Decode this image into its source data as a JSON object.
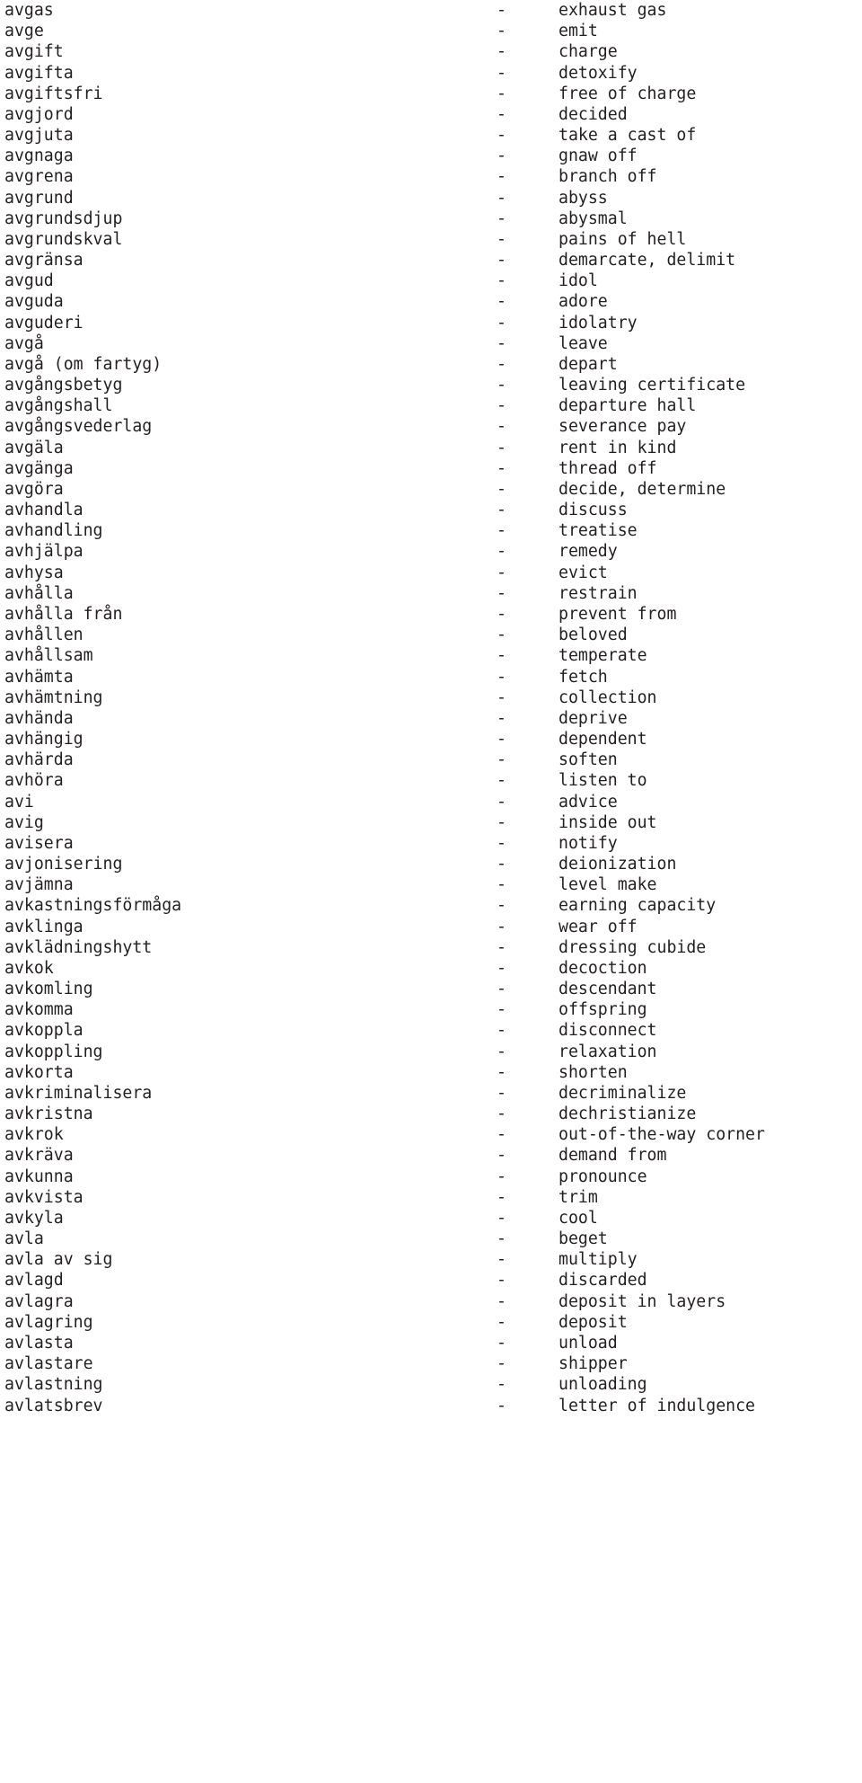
{
  "document": {
    "kind": "bilingual-glossary",
    "source_language": "Swedish",
    "target_language": "English",
    "separator": "-",
    "entries": [
      {
        "term": "avgas",
        "gloss": "exhaust gas"
      },
      {
        "term": "avge",
        "gloss": "emit"
      },
      {
        "term": "avgift",
        "gloss": "charge"
      },
      {
        "term": "avgifta",
        "gloss": "detoxify"
      },
      {
        "term": "avgiftsfri",
        "gloss": "free of charge"
      },
      {
        "term": "avgjord",
        "gloss": "decided"
      },
      {
        "term": "avgjuta",
        "gloss": "take a cast of"
      },
      {
        "term": "avgnaga",
        "gloss": "gnaw off"
      },
      {
        "term": "avgrena",
        "gloss": "branch off"
      },
      {
        "term": "avgrund",
        "gloss": "abyss"
      },
      {
        "term": "avgrundsdjup",
        "gloss": "abysmal"
      },
      {
        "term": "avgrundskval",
        "gloss": "pains of hell"
      },
      {
        "term": "avgränsa",
        "gloss": "demarcate, delimit"
      },
      {
        "term": "avgud",
        "gloss": "idol"
      },
      {
        "term": "avguda",
        "gloss": "adore"
      },
      {
        "term": "avguderi",
        "gloss": "idolatry"
      },
      {
        "term": "avgå",
        "gloss": "leave"
      },
      {
        "term": "avgå (om fartyg)",
        "gloss": "depart"
      },
      {
        "term": "avgångsbetyg",
        "gloss": "leaving certificate"
      },
      {
        "term": "avgångshall",
        "gloss": "departure hall"
      },
      {
        "term": "avgångsvederlag",
        "gloss": "severance pay"
      },
      {
        "term": "avgäla",
        "gloss": "rent in kind"
      },
      {
        "term": "avgänga",
        "gloss": "thread off"
      },
      {
        "term": "avgöra",
        "gloss": "decide, determine"
      },
      {
        "term": "avhandla",
        "gloss": "discuss"
      },
      {
        "term": "avhandling",
        "gloss": "treatise"
      },
      {
        "term": "avhjälpa",
        "gloss": "remedy"
      },
      {
        "term": "avhysa",
        "gloss": "evict"
      },
      {
        "term": "avhålla",
        "gloss": "restrain"
      },
      {
        "term": "avhålla från",
        "gloss": "prevent from"
      },
      {
        "term": "avhållen",
        "gloss": "beloved"
      },
      {
        "term": "avhållsam",
        "gloss": "temperate"
      },
      {
        "term": "avhämta",
        "gloss": "fetch"
      },
      {
        "term": "avhämtning",
        "gloss": "collection"
      },
      {
        "term": "avhända",
        "gloss": "deprive"
      },
      {
        "term": "avhängig",
        "gloss": "dependent"
      },
      {
        "term": "avhärda",
        "gloss": "soften"
      },
      {
        "term": "avhöra",
        "gloss": "listen to"
      },
      {
        "term": "avi",
        "gloss": "advice"
      },
      {
        "term": "avig",
        "gloss": "inside out"
      },
      {
        "term": "avisera",
        "gloss": "notify"
      },
      {
        "term": "avjonisering",
        "gloss": "deionization"
      },
      {
        "term": "avjämna",
        "gloss": "level make"
      },
      {
        "term": "avkastningsförmåga",
        "gloss": "earning capacity"
      },
      {
        "term": "avklinga",
        "gloss": "wear off"
      },
      {
        "term": "avklädningshytt",
        "gloss": "dressing cubide"
      },
      {
        "term": "avkok",
        "gloss": "decoction"
      },
      {
        "term": "avkomling",
        "gloss": "descendant"
      },
      {
        "term": "avkomma",
        "gloss": "offspring"
      },
      {
        "term": "avkoppla",
        "gloss": "disconnect"
      },
      {
        "term": "avkoppling",
        "gloss": "relaxation"
      },
      {
        "term": "avkorta",
        "gloss": "shorten"
      },
      {
        "term": "avkriminalisera",
        "gloss": "decriminalize"
      },
      {
        "term": "avkristna",
        "gloss": "dechristianize"
      },
      {
        "term": "avkrok",
        "gloss": "out-of-the-way corner"
      },
      {
        "term": "avkräva",
        "gloss": "demand from"
      },
      {
        "term": "avkunna",
        "gloss": "pronounce"
      },
      {
        "term": "avkvista",
        "gloss": "trim"
      },
      {
        "term": "avkyla",
        "gloss": "cool"
      },
      {
        "term": "avla",
        "gloss": "beget"
      },
      {
        "term": "avla av sig",
        "gloss": "multiply"
      },
      {
        "term": "avlagd",
        "gloss": "discarded"
      },
      {
        "term": "avlagra",
        "gloss": "deposit in layers"
      },
      {
        "term": "avlagring",
        "gloss": "deposit"
      },
      {
        "term": "avlasta",
        "gloss": "unload"
      },
      {
        "term": "avlastare",
        "gloss": "shipper"
      },
      {
        "term": "avlastning",
        "gloss": "unloading"
      },
      {
        "term": "avlatsbrev",
        "gloss": "letter of indulgence"
      }
    ]
  },
  "colors": {
    "background": "#ffffff",
    "text": "#231f20"
  }
}
